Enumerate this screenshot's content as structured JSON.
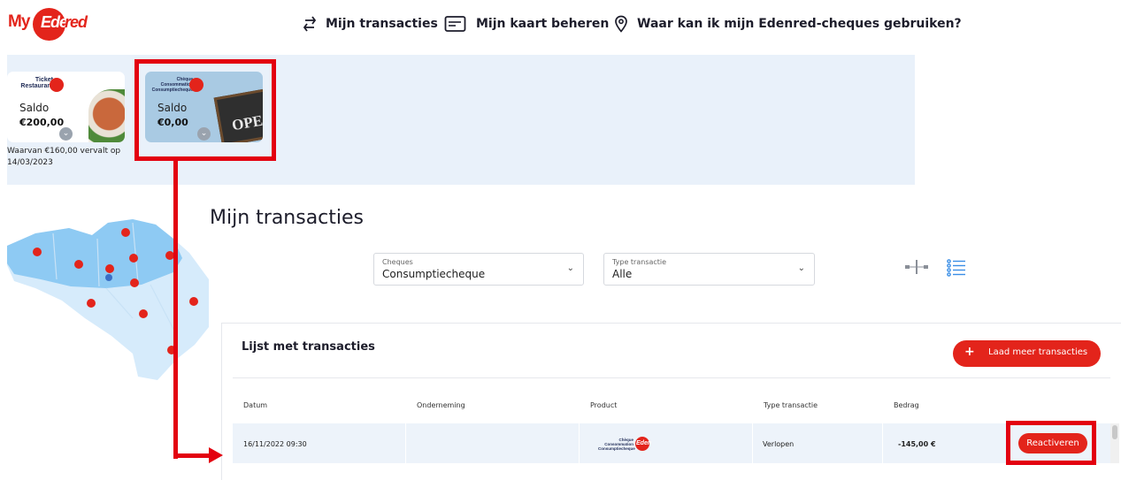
{
  "logo": {
    "my": "My",
    "ed": "Eden",
    "red": "red"
  },
  "nav": [
    {
      "label": "Mijn transacties",
      "icon": "swap-arrows-icon"
    },
    {
      "label": "Mijn kaart beheren",
      "icon": "card-icon"
    },
    {
      "label": "Waar kan ik mijn Edenred-cheques gebruiken?",
      "icon": "location-pin-icon"
    }
  ],
  "cards": [
    {
      "brand": "Ticket Restaurant",
      "saldo_label": "Saldo",
      "saldo": "€200,00",
      "note": "Waarvan €160,00 vervalt op 14/03/2023"
    },
    {
      "brand": "Chèque Consommation Consumptiecheque",
      "saldo_label": "Saldo",
      "saldo": "€0,00",
      "board_text": "OPE"
    }
  ],
  "page_title": "Mijn transacties",
  "filters": [
    {
      "label": "Cheques",
      "value": "Consumptiecheque"
    },
    {
      "label": "Type transactie",
      "value": "Alle"
    }
  ],
  "panel": {
    "title": "Lijst met transacties",
    "load_more": "Laad meer transacties",
    "columns": [
      "Datum",
      "Onderneming",
      "Product",
      "Type transactie",
      "Bedrag"
    ],
    "rows": [
      {
        "datum": "16/11/2022 09:30",
        "onderneming": "",
        "product": "Chèque Consommation Consumptiecheque",
        "type": "Verlopen",
        "bedrag": "-145,00 €",
        "action": "Reactiveren"
      }
    ]
  },
  "colors": {
    "brand_red": "#e3241b",
    "highlight_red": "#e3000f",
    "strip_bg": "#e9f1fa",
    "row_bg": "#edf3fa"
  }
}
